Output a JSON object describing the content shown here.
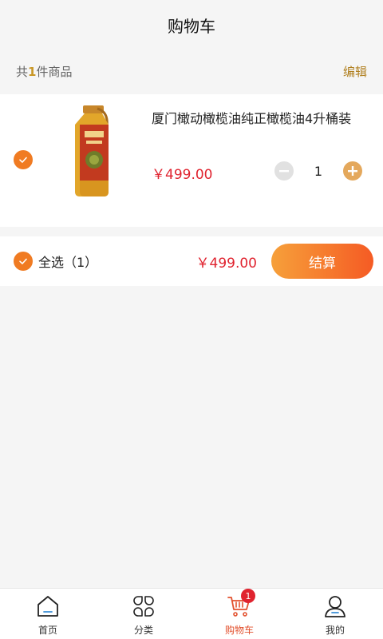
{
  "header": {
    "title": "购物车"
  },
  "summary": {
    "prefix": "共",
    "count": "1",
    "suffix": "件商品",
    "edit_label": "编辑"
  },
  "cart_item": {
    "title": "厦门橄动橄榄油纯正橄榄油4升桶装",
    "price": "￥499.00",
    "quantity": "1",
    "selected": true
  },
  "select_bar": {
    "select_all_label": "全选（1）",
    "total": "￥499.00",
    "checkout_label": "结算"
  },
  "tabbar": {
    "items": [
      {
        "label": "首页",
        "icon": "home-icon"
      },
      {
        "label": "分类",
        "icon": "category-icon"
      },
      {
        "label": "购物车",
        "icon": "cart-icon",
        "active": true,
        "badge": "1"
      },
      {
        "label": "我的",
        "icon": "profile-icon"
      }
    ]
  },
  "colors": {
    "accent": "#f07b22",
    "price": "#e0232f",
    "active_tab": "#e2512e",
    "edit": "#b07f1e"
  }
}
